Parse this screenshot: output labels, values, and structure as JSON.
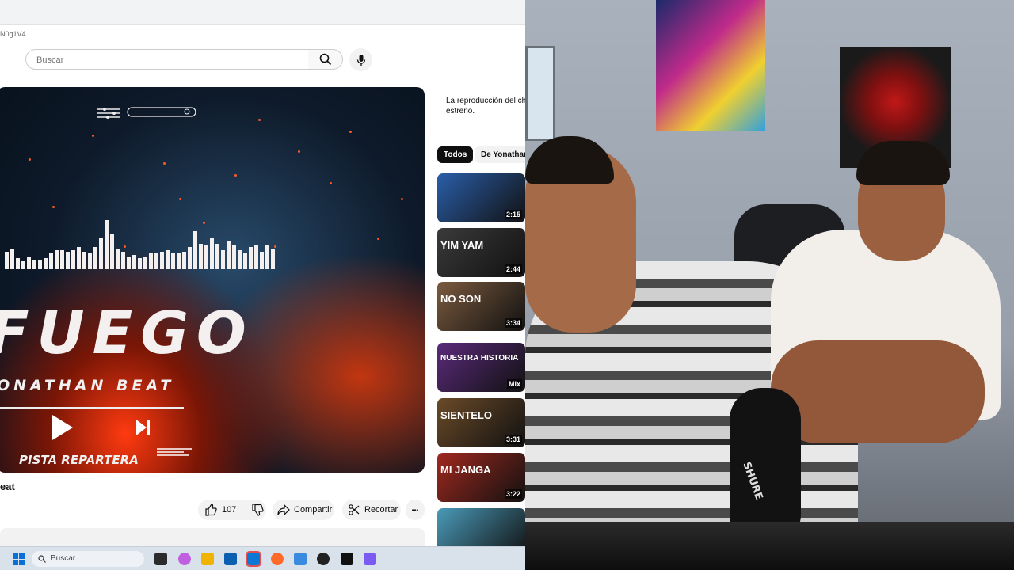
{
  "browser": {
    "url_fragment": "N0g1V4",
    "search_placeholder": "Buscar"
  },
  "video": {
    "art_title": "FUEGO",
    "art_artist": "ONATHAN BEAT",
    "art_subtitle": "PISTA REPARTERA",
    "title": "eat",
    "likes": "107",
    "share_label": "Compartir",
    "clip_label": "Recortar",
    "more_label": "•••"
  },
  "sidebar": {
    "chat_message_line1": "La reproducción del cha",
    "chat_message_line2": "estreno.",
    "chips": [
      "Todos",
      "De Yonathan"
    ],
    "thumbs": [
      {
        "caption": "",
        "duration": "2:15",
        "bg": "#2a5ea8"
      },
      {
        "caption": "YIM YAM",
        "duration": "2:44",
        "bg": "#3a3a3a"
      },
      {
        "caption": "NO SON",
        "duration": "3:34",
        "bg": "#7a5a3e"
      },
      {
        "caption": "NUESTRA HISTORIA",
        "duration": "Mix",
        "bg": "#5a2a7a"
      },
      {
        "caption": "SIENTELO",
        "duration": "3:31",
        "bg": "#6a4a28"
      },
      {
        "caption": "MI JANGA",
        "duration": "3:22",
        "bg": "#a0281e"
      },
      {
        "caption": "",
        "duration": "",
        "bg": "#4a9ab8"
      }
    ]
  },
  "taskbar": {
    "search_placeholder": "Buscar"
  },
  "webcam": {
    "mic_brand": "SHURE"
  }
}
